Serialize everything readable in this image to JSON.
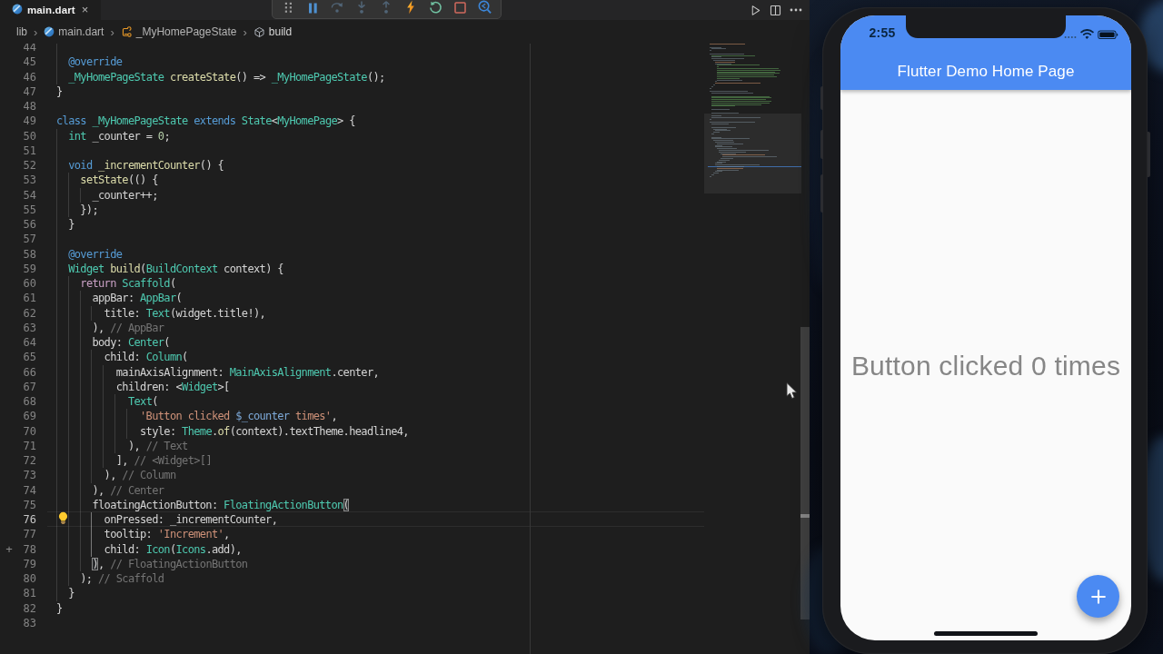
{
  "window": {
    "tab": {
      "icon": "dart-file-icon",
      "label": "main.dart",
      "close": "×"
    },
    "tab_actions": [
      {
        "name": "run-button",
        "icon": "play-icon"
      },
      {
        "name": "split-editor-button",
        "icon": "split-editor-icon"
      },
      {
        "name": "more-actions-button",
        "icon": "ellipsis-icon"
      }
    ]
  },
  "debug_toolbar": {
    "buttons": [
      {
        "name": "drag-handle",
        "icon": "gripper-icon",
        "enabled": true
      },
      {
        "name": "pause-button",
        "icon": "pause-icon",
        "enabled": true
      },
      {
        "name": "step-over-button",
        "icon": "step-over-icon",
        "enabled": false
      },
      {
        "name": "step-into-button",
        "icon": "step-into-icon",
        "enabled": false
      },
      {
        "name": "step-out-button",
        "icon": "step-out-icon",
        "enabled": false
      },
      {
        "name": "hot-reload-button",
        "icon": "hot-reload-icon",
        "enabled": true
      },
      {
        "name": "restart-button",
        "icon": "restart-icon",
        "enabled": true
      },
      {
        "name": "stop-button",
        "icon": "stop-icon",
        "enabled": true
      },
      {
        "name": "widget-inspector-button",
        "icon": "inspector-icon",
        "enabled": true
      }
    ]
  },
  "breadcrumbs": [
    {
      "label": "lib",
      "icon": null
    },
    {
      "label": "main.dart",
      "icon": "dart"
    },
    {
      "label": "_MyHomePageState",
      "icon": "class"
    },
    {
      "label": "build",
      "icon": "method"
    }
  ],
  "editor": {
    "palette": {
      "fg": "#d4d4d4",
      "kw": "#569cd6",
      "ctl": "#c9a0c4",
      "ty": "#4ec9b0",
      "fn": "#dcdcaa",
      "str": "#ce9178",
      "num": "#b5cea8",
      "iv": "#7da9d8",
      "lbl": "#747474"
    },
    "lines": [
      {
        "n": 44,
        "spans": [],
        "g": 1
      },
      {
        "n": 45,
        "spans": [
          {
            "t": "  ",
            "c": "fg"
          },
          {
            "t": "@override",
            "c": "kw"
          }
        ],
        "g": 1
      },
      {
        "n": 46,
        "spans": [
          {
            "t": "  ",
            "c": "fg"
          },
          {
            "t": "_MyHomePageState",
            "c": "ty"
          },
          {
            "t": " ",
            "c": "fg"
          },
          {
            "t": "createState",
            "c": "fn"
          },
          {
            "t": "() => ",
            "c": "fg"
          },
          {
            "t": "_MyHomePageState",
            "c": "ty"
          },
          {
            "t": "();",
            "c": "fg"
          }
        ],
        "g": 1
      },
      {
        "n": 47,
        "spans": [
          {
            "t": "}",
            "c": "fg"
          }
        ],
        "g": 0
      },
      {
        "n": 48,
        "spans": [],
        "g": 0
      },
      {
        "n": 49,
        "spans": [
          {
            "t": "class",
            "c": "kw"
          },
          {
            "t": " ",
            "c": "fg"
          },
          {
            "t": "_MyHomePageState",
            "c": "ty"
          },
          {
            "t": " ",
            "c": "fg"
          },
          {
            "t": "extends",
            "c": "kw"
          },
          {
            "t": " ",
            "c": "fg"
          },
          {
            "t": "State",
            "c": "ty"
          },
          {
            "t": "<",
            "c": "fg"
          },
          {
            "t": "MyHomePage",
            "c": "ty"
          },
          {
            "t": "> {",
            "c": "fg"
          }
        ],
        "g": 0
      },
      {
        "n": 50,
        "spans": [
          {
            "t": "  ",
            "c": "fg"
          },
          {
            "t": "int",
            "c": "ty"
          },
          {
            "t": " _counter = ",
            "c": "fg"
          },
          {
            "t": "0",
            "c": "num"
          },
          {
            "t": ";",
            "c": "fg"
          }
        ],
        "g": 1
      },
      {
        "n": 51,
        "spans": [],
        "g": 1
      },
      {
        "n": 52,
        "spans": [
          {
            "t": "  ",
            "c": "fg"
          },
          {
            "t": "void",
            "c": "kw"
          },
          {
            "t": " ",
            "c": "fg"
          },
          {
            "t": "_incrementCounter",
            "c": "fn"
          },
          {
            "t": "() {",
            "c": "fg"
          }
        ],
        "g": 1
      },
      {
        "n": 53,
        "spans": [
          {
            "t": "    ",
            "c": "fg"
          },
          {
            "t": "setState",
            "c": "fn"
          },
          {
            "t": "(() {",
            "c": "fg"
          }
        ],
        "g": 2
      },
      {
        "n": 54,
        "spans": [
          {
            "t": "      _counter++;",
            "c": "fg"
          }
        ],
        "g": 3
      },
      {
        "n": 55,
        "spans": [
          {
            "t": "    });",
            "c": "fg"
          }
        ],
        "g": 2
      },
      {
        "n": 56,
        "spans": [
          {
            "t": "  }",
            "c": "fg"
          }
        ],
        "g": 1
      },
      {
        "n": 57,
        "spans": [],
        "g": 1
      },
      {
        "n": 58,
        "spans": [
          {
            "t": "  ",
            "c": "fg"
          },
          {
            "t": "@override",
            "c": "kw"
          }
        ],
        "g": 1
      },
      {
        "n": 59,
        "spans": [
          {
            "t": "  ",
            "c": "fg"
          },
          {
            "t": "Widget",
            "c": "ty"
          },
          {
            "t": " ",
            "c": "fg"
          },
          {
            "t": "build",
            "c": "fn"
          },
          {
            "t": "(",
            "c": "fg"
          },
          {
            "t": "BuildContext",
            "c": "ty"
          },
          {
            "t": " context) {",
            "c": "fg"
          }
        ],
        "g": 1
      },
      {
        "n": 60,
        "spans": [
          {
            "t": "    ",
            "c": "fg"
          },
          {
            "t": "return",
            "c": "ctl"
          },
          {
            "t": " ",
            "c": "fg"
          },
          {
            "t": "Scaffold",
            "c": "ty"
          },
          {
            "t": "(",
            "c": "fg"
          }
        ],
        "g": 2
      },
      {
        "n": 61,
        "spans": [
          {
            "t": "      appBar: ",
            "c": "fg"
          },
          {
            "t": "AppBar",
            "c": "ty"
          },
          {
            "t": "(",
            "c": "fg"
          }
        ],
        "g": 3
      },
      {
        "n": 62,
        "spans": [
          {
            "t": "        title: ",
            "c": "fg"
          },
          {
            "t": "Text",
            "c": "ty"
          },
          {
            "t": "(widget.title!),",
            "c": "fg"
          }
        ],
        "g": 4
      },
      {
        "n": 63,
        "spans": [
          {
            "t": "      ), ",
            "c": "fg"
          },
          {
            "t": "// AppBar",
            "c": "lbl"
          }
        ],
        "g": 3
      },
      {
        "n": 64,
        "spans": [
          {
            "t": "      body: ",
            "c": "fg"
          },
          {
            "t": "Center",
            "c": "ty"
          },
          {
            "t": "(",
            "c": "fg"
          }
        ],
        "g": 3
      },
      {
        "n": 65,
        "spans": [
          {
            "t": "        child: ",
            "c": "fg"
          },
          {
            "t": "Column",
            "c": "ty"
          },
          {
            "t": "(",
            "c": "fg"
          }
        ],
        "g": 4
      },
      {
        "n": 66,
        "spans": [
          {
            "t": "          mainAxisAlignment: ",
            "c": "fg"
          },
          {
            "t": "MainAxisAlignment",
            "c": "ty"
          },
          {
            "t": ".center,",
            "c": "fg"
          }
        ],
        "g": 5
      },
      {
        "n": 67,
        "spans": [
          {
            "t": "          children: <",
            "c": "fg"
          },
          {
            "t": "Widget",
            "c": "ty"
          },
          {
            "t": ">[",
            "c": "fg"
          }
        ],
        "g": 5
      },
      {
        "n": 68,
        "spans": [
          {
            "t": "            ",
            "c": "fg"
          },
          {
            "t": "Text",
            "c": "ty"
          },
          {
            "t": "(",
            "c": "fg"
          }
        ],
        "g": 6
      },
      {
        "n": 69,
        "spans": [
          {
            "t": "              ",
            "c": "fg"
          },
          {
            "t": "'Button clicked ",
            "c": "str"
          },
          {
            "t": "$_counter",
            "c": "iv"
          },
          {
            "t": " times'",
            "c": "str"
          },
          {
            "t": ",",
            "c": "fg"
          }
        ],
        "g": 7
      },
      {
        "n": 70,
        "spans": [
          {
            "t": "              style: ",
            "c": "fg"
          },
          {
            "t": "Theme",
            "c": "ty"
          },
          {
            "t": ".",
            "c": "fg"
          },
          {
            "t": "of",
            "c": "fn"
          },
          {
            "t": "(context).textTheme.headline4,",
            "c": "fg"
          }
        ],
        "g": 7
      },
      {
        "n": 71,
        "spans": [
          {
            "t": "            ), ",
            "c": "fg"
          },
          {
            "t": "// Text",
            "c": "lbl"
          }
        ],
        "g": 6
      },
      {
        "n": 72,
        "spans": [
          {
            "t": "          ], ",
            "c": "fg"
          },
          {
            "t": "// <Widget>[]",
            "c": "lbl"
          }
        ],
        "g": 5
      },
      {
        "n": 73,
        "spans": [
          {
            "t": "        ), ",
            "c": "fg"
          },
          {
            "t": "// Column",
            "c": "lbl"
          }
        ],
        "g": 4
      },
      {
        "n": 74,
        "spans": [
          {
            "t": "      ), ",
            "c": "fg"
          },
          {
            "t": "// Center",
            "c": "lbl"
          }
        ],
        "g": 3
      },
      {
        "n": 75,
        "spans": [
          {
            "t": "      floatingActionButton: ",
            "c": "fg"
          },
          {
            "t": "FloatingActionButton",
            "c": "ty"
          },
          {
            "t": "(",
            "c": "fg",
            "m": 1
          }
        ],
        "g": 3
      },
      {
        "n": 76,
        "spans": [
          {
            "t": "        onPressed: _incrementCounter,",
            "c": "fg"
          }
        ],
        "g": 4,
        "ag": 3,
        "cur": 1,
        "bulb": 1
      },
      {
        "n": 77,
        "spans": [
          {
            "t": "        tooltip: ",
            "c": "fg"
          },
          {
            "t": "'Increment'",
            "c": "str"
          },
          {
            "t": ",",
            "c": "fg"
          }
        ],
        "g": 4,
        "ag": 3
      },
      {
        "n": 78,
        "spans": [
          {
            "t": "        child: ",
            "c": "fg"
          },
          {
            "t": "Icon",
            "c": "ty"
          },
          {
            "t": "(",
            "c": "fg"
          },
          {
            "t": "Icons",
            "c": "ty"
          },
          {
            "t": ".add),",
            "c": "fg"
          }
        ],
        "g": 4,
        "ag": 3,
        "plus": 1
      },
      {
        "n": 79,
        "spans": [
          {
            "t": "      ",
            "c": "fg"
          },
          {
            "t": ")",
            "c": "fg",
            "m": 1
          },
          {
            "t": ", ",
            "c": "fg"
          },
          {
            "t": "// FloatingActionButton",
            "c": "lbl"
          }
        ],
        "g": 3
      },
      {
        "n": 80,
        "spans": [
          {
            "t": "    ); ",
            "c": "fg"
          },
          {
            "t": "// Scaffold",
            "c": "lbl"
          }
        ],
        "g": 2
      },
      {
        "n": 81,
        "spans": [
          {
            "t": "  }",
            "c": "fg"
          }
        ],
        "g": 1
      },
      {
        "n": 82,
        "spans": [
          {
            "t": "}",
            "c": "fg"
          }
        ],
        "g": 0
      },
      {
        "n": 83,
        "spans": [],
        "g": 0
      }
    ],
    "gutter_plus": "+"
  },
  "minimap": {
    "lines": [
      {
        "i": 0,
        "w": 39,
        "k": "o"
      },
      {
        "i": 0,
        "w": 0,
        "k": "c"
      },
      {
        "i": 0,
        "w": 13,
        "k": "c"
      },
      {
        "i": 2,
        "w": 16,
        "k": "c"
      },
      {
        "i": 0,
        "w": 1,
        "k": "c"
      },
      {
        "i": 0,
        "w": 0,
        "k": "c"
      },
      {
        "i": 0,
        "w": 38,
        "k": "c"
      },
      {
        "i": 2,
        "w": 48,
        "k": "g"
      },
      {
        "i": 2,
        "w": 11,
        "k": "c"
      },
      {
        "i": 2,
        "w": 36,
        "k": "c"
      },
      {
        "i": 4,
        "w": 24,
        "k": "c"
      },
      {
        "i": 6,
        "w": 22,
        "k": "o"
      },
      {
        "i": 6,
        "w": 18,
        "k": "c"
      },
      {
        "i": 8,
        "w": 47,
        "k": "g"
      },
      {
        "i": 8,
        "w": 2,
        "k": "g"
      },
      {
        "i": 8,
        "w": 68,
        "k": "g"
      },
      {
        "i": 8,
        "w": 70,
        "k": "g"
      },
      {
        "i": 8,
        "w": 64,
        "k": "g"
      },
      {
        "i": 8,
        "w": 69,
        "k": "g"
      },
      {
        "i": 8,
        "w": 63,
        "k": "g"
      },
      {
        "i": 8,
        "w": 66,
        "k": "g"
      },
      {
        "i": 8,
        "w": 25,
        "k": "g"
      },
      {
        "i": 8,
        "w": 28,
        "k": "c"
      },
      {
        "i": 6,
        "w": 2,
        "k": "c"
      },
      {
        "i": 6,
        "w": 50,
        "k": "o"
      },
      {
        "i": 4,
        "w": 2,
        "k": "c"
      },
      {
        "i": 2,
        "w": 1,
        "k": "c"
      },
      {
        "i": 0,
        "w": 1,
        "k": "c"
      },
      {
        "i": 0,
        "w": 0,
        "k": "c"
      },
      {
        "i": 0,
        "w": 42,
        "k": "c"
      },
      {
        "i": 2,
        "w": 46,
        "k": "c"
      },
      {
        "i": 0,
        "w": 0,
        "k": "c"
      },
      {
        "i": 2,
        "w": 64,
        "k": "g"
      },
      {
        "i": 2,
        "w": 66,
        "k": "g"
      },
      {
        "i": 2,
        "w": 60,
        "k": "g"
      },
      {
        "i": 2,
        "w": 66,
        "k": "g"
      },
      {
        "i": 2,
        "w": 64,
        "k": "g"
      },
      {
        "i": 2,
        "w": 55,
        "k": "g"
      },
      {
        "i": 2,
        "w": 26,
        "k": "g"
      },
      {
        "i": 0,
        "w": 0,
        "k": "c"
      },
      {
        "i": 2,
        "w": 20,
        "k": "c"
      },
      {
        "i": 0,
        "w": 0,
        "k": "c"
      },
      {
        "i": 2,
        "w": 30,
        "k": "c"
      },
      {
        "i": 0,
        "w": 0,
        "k": "c"
      },
      {
        "i": 2,
        "w": 11,
        "k": "c"
      },
      {
        "i": 2,
        "w": 54,
        "k": "c"
      },
      {
        "i": 0,
        "w": 1,
        "k": "c"
      },
      {
        "i": 0,
        "w": 0,
        "k": "c"
      },
      {
        "i": 0,
        "w": 50,
        "k": "c"
      },
      {
        "i": 2,
        "w": 19,
        "k": "c"
      },
      {
        "i": 0,
        "w": 0,
        "k": "c"
      },
      {
        "i": 2,
        "w": 27,
        "k": "c"
      },
      {
        "i": 4,
        "w": 15,
        "k": "c"
      },
      {
        "i": 6,
        "w": 17,
        "k": "c"
      },
      {
        "i": 4,
        "w": 7,
        "k": "c"
      },
      {
        "i": 2,
        "w": 3,
        "k": "c"
      },
      {
        "i": 0,
        "w": 0,
        "k": "c"
      },
      {
        "i": 2,
        "w": 11,
        "k": "c"
      },
      {
        "i": 2,
        "w": 42,
        "k": "c"
      },
      {
        "i": 4,
        "w": 22,
        "k": "c"
      },
      {
        "i": 6,
        "w": 21,
        "k": "c"
      },
      {
        "i": 8,
        "w": 29,
        "k": "c"
      },
      {
        "i": 6,
        "w": 8,
        "k": "c"
      },
      {
        "i": 6,
        "w": 19,
        "k": "c"
      },
      {
        "i": 8,
        "w": 22,
        "k": "c"
      },
      {
        "i": 10,
        "w": 55,
        "k": "c"
      },
      {
        "i": 10,
        "w": 30,
        "k": "c"
      },
      {
        "i": 12,
        "w": 17,
        "k": "c"
      },
      {
        "i": 14,
        "w": 47,
        "k": "o"
      },
      {
        "i": 14,
        "w": 60,
        "k": "c"
      },
      {
        "i": 12,
        "w": 14,
        "k": "c"
      },
      {
        "i": 10,
        "w": 12,
        "k": "c"
      },
      {
        "i": 8,
        "w": 10,
        "k": "c"
      },
      {
        "i": 6,
        "w": 8,
        "k": "c"
      },
      {
        "i": 6,
        "w": 49,
        "k": "c"
      },
      {
        "i": 8,
        "w": 30,
        "k": "c"
      },
      {
        "i": 8,
        "w": 29,
        "k": "o"
      },
      {
        "i": 8,
        "w": 24,
        "k": "c"
      },
      {
        "i": 6,
        "w": 8,
        "k": "c"
      },
      {
        "i": 4,
        "w": 6,
        "k": "c"
      },
      {
        "i": 2,
        "w": 3,
        "k": "c"
      },
      {
        "i": 0,
        "w": 1,
        "k": "c"
      },
      {
        "i": 0,
        "w": 0,
        "k": "c"
      }
    ]
  },
  "phone": {
    "status": {
      "time": "2:55",
      "icons": [
        "signal-dots-icon",
        "wifi-icon",
        "battery-icon"
      ]
    },
    "appbar": {
      "title": "Flutter Demo Home Page"
    },
    "body": {
      "text": "Button clicked 0 times"
    },
    "fab": {
      "glyph": "+"
    },
    "colors": {
      "primary": "#4b8af2",
      "body_bg": "#fafafa",
      "text": "#868686"
    }
  }
}
